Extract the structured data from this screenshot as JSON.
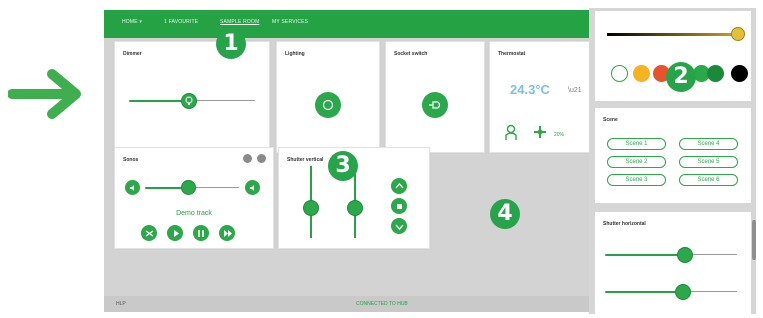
{
  "topbar": {
    "tabs": [
      "HOME ▾",
      "1 FAVOURITE",
      "SAMPLE ROOM",
      "MY SERVICES"
    ]
  },
  "cards": {
    "dimmer": {
      "title": "Dimmer",
      "level": 0.38
    },
    "lighting": {
      "title": "Lighting"
    },
    "socket": {
      "title": "Socket switch"
    },
    "thermostat": {
      "title": "Thermostat",
      "temperature": "24.3°C",
      "setpoint": "\\u21",
      "humidity": "20%"
    },
    "sonos": {
      "title": "Sonos",
      "now_playing": "Demo track",
      "volume": 0.45
    },
    "shutter": {
      "title": "Shutter vertical"
    }
  },
  "statusbar": {
    "left": "HLP",
    "center": "CONNECTED TO HUB"
  },
  "right_panel": {
    "color_slider_level": 0.95,
    "swatch_colors": [
      "#ffffff",
      "#f6b21f",
      "#e8532e",
      "#2aa84a",
      "#1a8a3a",
      "#000000"
    ],
    "scene_title": "Scene",
    "scenes": [
      "Scene 1",
      "Scene 4",
      "Scene 2",
      "Scene 5",
      "Scene 3",
      "Scene 6"
    ],
    "shutter_title": "Shutter horizontal",
    "shutter_levels": [
      0.6,
      0.58
    ]
  },
  "markers": [
    "1",
    "2",
    "3",
    "4"
  ],
  "colors": {
    "accent": "#26a449",
    "temp": "#7fbfe3"
  }
}
